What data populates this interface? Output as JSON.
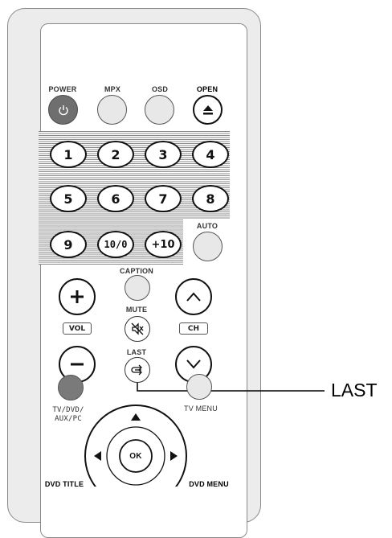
{
  "labels": {
    "power": "POWER",
    "mpx": "MPX",
    "osd": "OSD",
    "open": "OPEN",
    "auto": "AUTO",
    "caption": "CAPTION",
    "mute": "MUTE",
    "last": "LAST",
    "vol": "VOL",
    "ch": "CH",
    "tv_dvd_line1": "TV/DVD/",
    "tv_dvd_line2": "AUX/PC",
    "tv_menu": "TV MENU",
    "dvd_title": "DVD TITLE",
    "dvd_menu": "DVD MENU",
    "ok": "OK"
  },
  "number_buttons": [
    "1",
    "2",
    "3",
    "4",
    "5",
    "6",
    "7",
    "8",
    "9",
    "10/0",
    "+10"
  ],
  "callout": {
    "text": "LAST"
  },
  "colors": {
    "power_button": "#6f6f6f",
    "tv_dvd_button": "#7a7a7a",
    "hatch": "#8a8a8a",
    "remote_body": "#ececec"
  }
}
